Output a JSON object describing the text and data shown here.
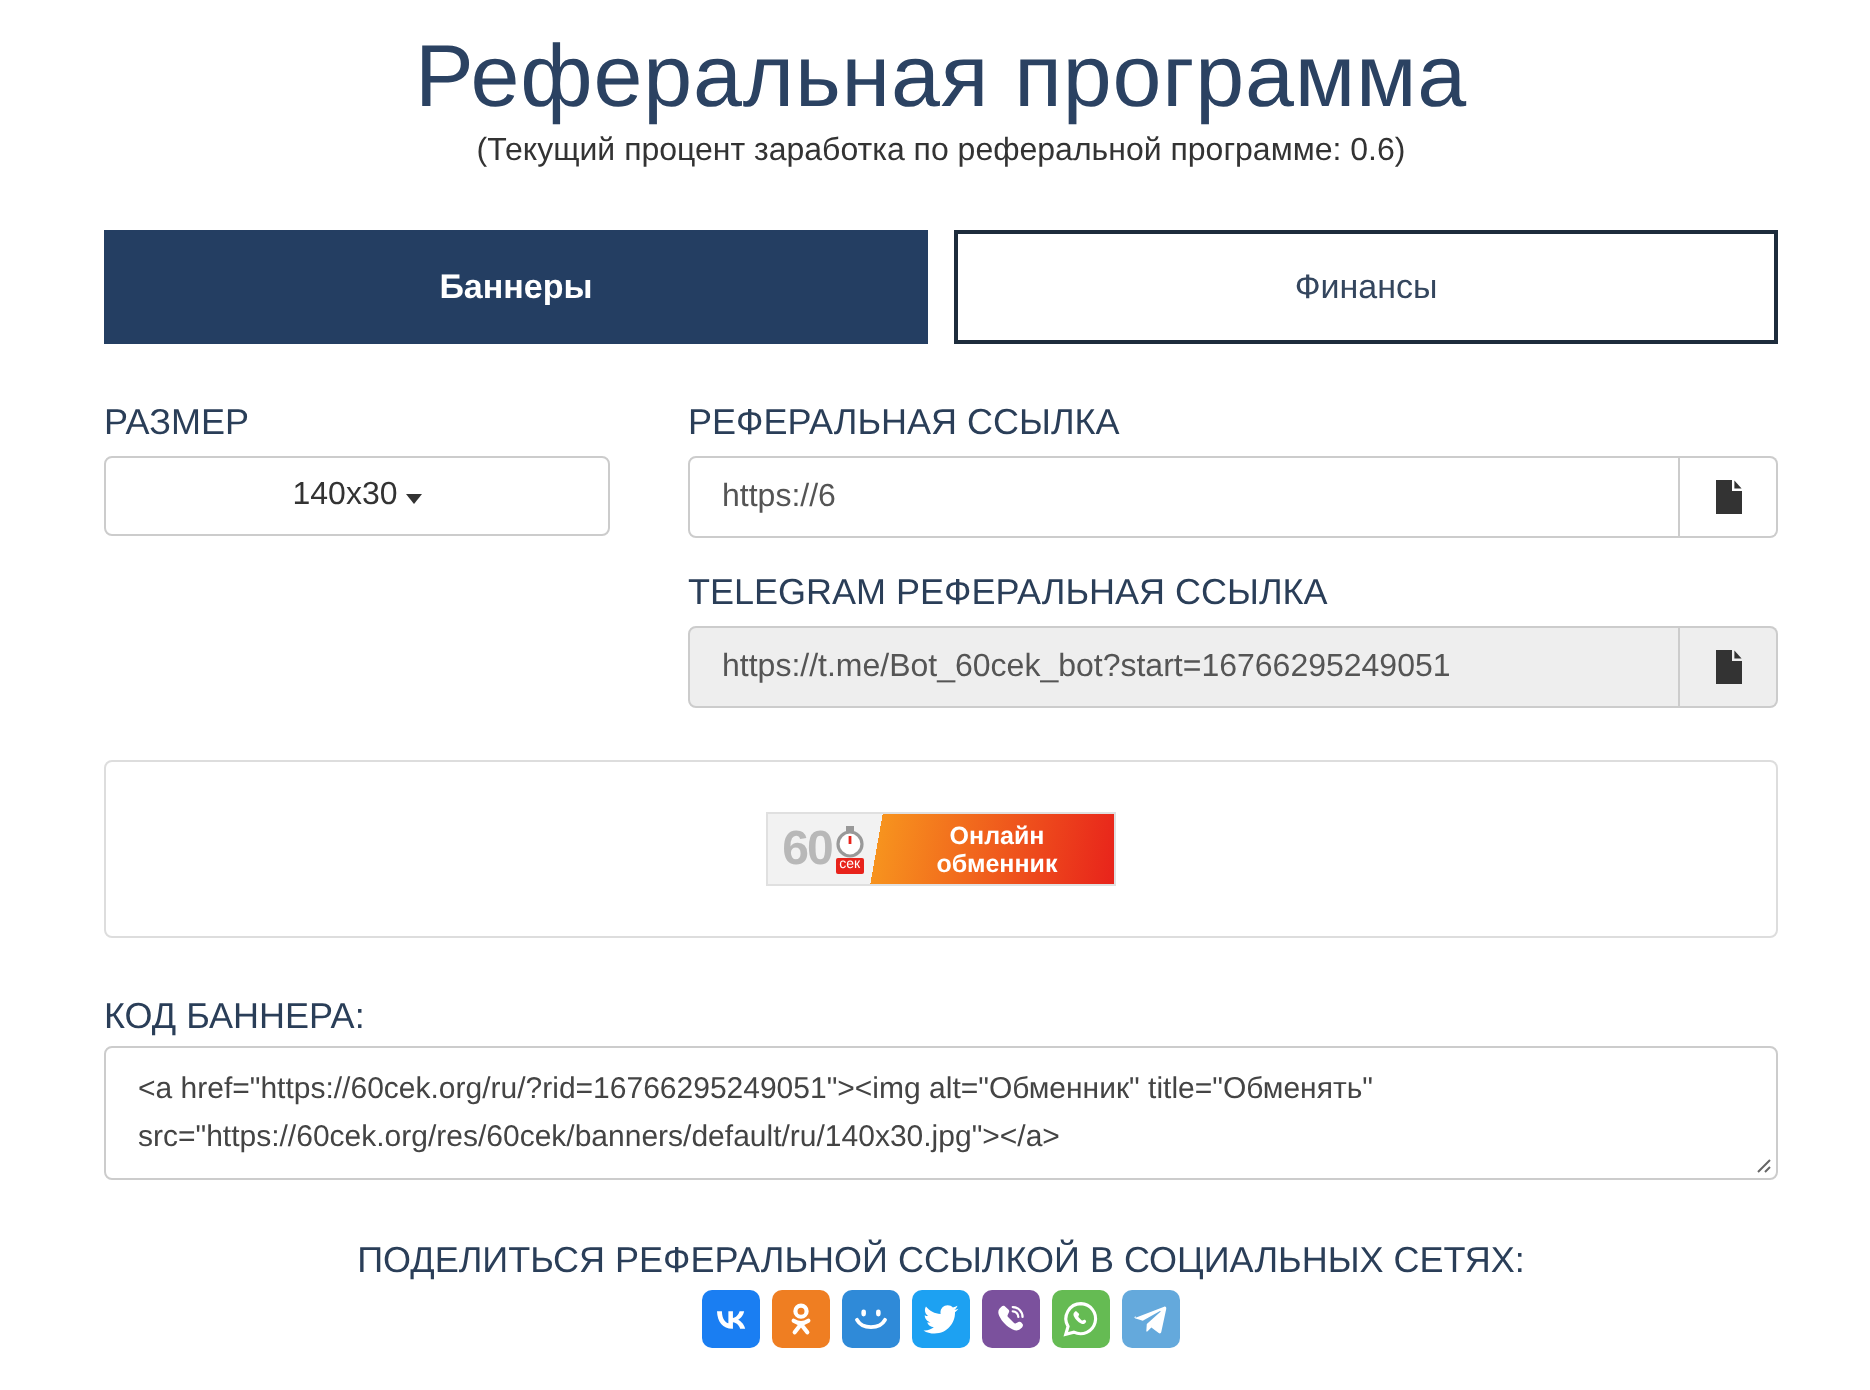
{
  "title": "Реферальная программа",
  "subtitle": "(Текущий процент заработка по реферальной программе: 0.6)",
  "tabs": [
    {
      "label": "Баннеры",
      "selected": true
    },
    {
      "label": "Финансы",
      "selected": false
    }
  ],
  "size": {
    "label": "РАЗМЕР",
    "value": "140x30"
  },
  "links": [
    {
      "label": "РЕФЕРАЛЬНАЯ ССЫЛКА",
      "value": "https://6",
      "disabled": false
    },
    {
      "label": "TELEGRAM РЕФЕРАЛЬНАЯ ССЫЛКА",
      "value": "https://t.me/Bot_60cek_bot?start=16766295249051",
      "disabled": true
    }
  ],
  "banner_preview": {
    "logo_number": "60",
    "logo_badge": "сек",
    "text": "Онлайн обменник"
  },
  "banner_code": {
    "label": "КОД БАННЕРА:",
    "value": "<a href=\"https://60cek.org/ru/?rid=16766295249051\"><img alt=\"Обменник\" title=\"Обменять\" src=\"https://60cek.org/res/60cek/banners/default/ru/140x30.jpg\"></a>"
  },
  "share": {
    "label": "ПОДЕЛИТЬСЯ РЕФЕРАЛЬНОЙ ССЫЛКОЙ В СОЦИАЛЬНЫХ СЕТЯХ:",
    "networks": [
      {
        "kind": "vk",
        "color": "#1a7ef2"
      },
      {
        "kind": "ok",
        "color": "#ef7e22"
      },
      {
        "kind": "mailru",
        "color": "#2f8ad8"
      },
      {
        "kind": "twitter",
        "color": "#1da1f2"
      },
      {
        "kind": "viber",
        "color": "#7b519d"
      },
      {
        "kind": "whatsapp",
        "color": "#65bb53"
      },
      {
        "kind": "telegram",
        "color": "#64a9dc"
      }
    ]
  }
}
